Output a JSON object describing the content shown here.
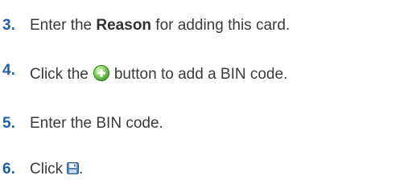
{
  "steps": [
    {
      "number": "3.",
      "text_before": "Enter the ",
      "bold": "Reason",
      "text_after": " for adding this card."
    },
    {
      "number": "4.",
      "text_before": "Click the",
      "icon": "add-circle-icon",
      "text_after": "button to add a BIN code."
    },
    {
      "number": "5.",
      "text": "Enter the BIN code."
    },
    {
      "number": "6.",
      "text_before": "Click",
      "icon": "save-icon",
      "text_after": "."
    }
  ],
  "colors": {
    "step_number": "#1f5fa5",
    "body_text": "#3a3a3a",
    "add_icon": "#4aa82e",
    "save_icon": "#4a7fc1"
  }
}
